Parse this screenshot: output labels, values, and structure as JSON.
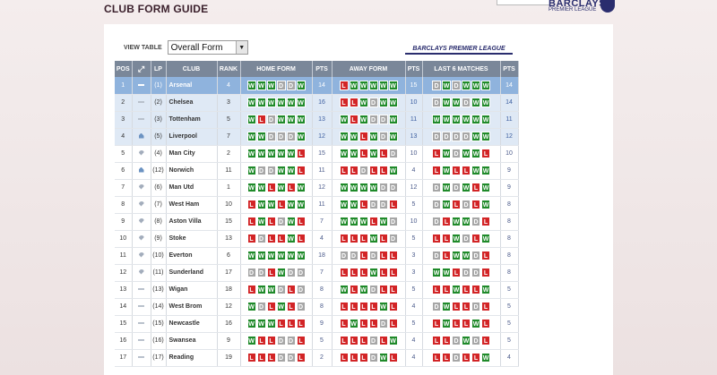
{
  "page_title": "CLUB FORM GUIDE",
  "branding": {
    "top_logo_line1": "BARCLAYS",
    "top_logo_line2": "PREMIER LEAGUE",
    "league_logo": "BARCLAYS PREMIER LEAGUE"
  },
  "controls": {
    "view_table_label": "VIEW TABLE",
    "selected": "Overall Form",
    "arrow": "▼"
  },
  "colors": {
    "win": "#1f8a2a",
    "loss": "#d22426",
    "draw": "#a6a6a6",
    "header": "#7a8799",
    "highlight": "#8fb3dd"
  },
  "columns": [
    "POS",
    "",
    "LP",
    "CLUB",
    "RANK",
    "HOME FORM",
    "PTS",
    "AWAY FORM",
    "PTS",
    "LAST 6 MATCHES",
    "PTS"
  ],
  "columns_icon": "swap-icon",
  "rows": [
    {
      "pos": "1",
      "move": "same",
      "lp": "(1)",
      "club": "Arsenal",
      "rank": "4",
      "home": "WWWDDW",
      "home_pts": "14",
      "away": "LWWWWW",
      "away_pts": "15",
      "last6": "DWDWWW",
      "last6_pts": "14",
      "style": "hl"
    },
    {
      "pos": "2",
      "move": "same",
      "lp": "(2)",
      "club": "Chelsea",
      "rank": "3",
      "home": "WWWWWW",
      "home_pts": "16",
      "away": "LLWDWW",
      "away_pts": "10",
      "last6": "DWWDWW",
      "last6_pts": "14",
      "style": "q"
    },
    {
      "pos": "3",
      "move": "same",
      "lp": "(3)",
      "club": "Tottenham",
      "rank": "5",
      "home": "WLDWWW",
      "home_pts": "13",
      "away": "WLWDDW",
      "away_pts": "11",
      "last6": "WWWWWW",
      "last6_pts": "11",
      "style": "q"
    },
    {
      "pos": "4",
      "move": "up",
      "lp": "(5)",
      "club": "Liverpool",
      "rank": "7",
      "home": "WWDDDW",
      "home_pts": "12",
      "away": "WWLWDW",
      "away_pts": "13",
      "last6": "DDDDWW",
      "last6_pts": "12",
      "style": "q"
    },
    {
      "pos": "5",
      "move": "down",
      "lp": "(4)",
      "club": "Man City",
      "rank": "2",
      "home": "WWWWWL",
      "home_pts": "15",
      "away": "WWLWLD",
      "away_pts": "10",
      "last6": "LWDWWL",
      "last6_pts": "10",
      "style": ""
    },
    {
      "pos": "6",
      "move": "up",
      "lp": "(12)",
      "club": "Norwich",
      "rank": "11",
      "home": "WDDWWL",
      "home_pts": "11",
      "away": "LLDLLW",
      "away_pts": "4",
      "last6": "LWLLWW",
      "last6_pts": "9",
      "style": ""
    },
    {
      "pos": "7",
      "move": "down",
      "lp": "(6)",
      "club": "Man Utd",
      "rank": "1",
      "home": "WWLWLW",
      "home_pts": "12",
      "away": "WWWWDD",
      "away_pts": "12",
      "last6": "DWDWLW",
      "last6_pts": "9",
      "style": ""
    },
    {
      "pos": "8",
      "move": "down",
      "lp": "(7)",
      "club": "West Ham",
      "rank": "10",
      "home": "LWWLWW",
      "home_pts": "11",
      "away": "WWLDDL",
      "away_pts": "5",
      "last6": "DWLDLW",
      "last6_pts": "8",
      "style": ""
    },
    {
      "pos": "9",
      "move": "down",
      "lp": "(8)",
      "club": "Aston Villa",
      "rank": "15",
      "home": "LWLDWL",
      "home_pts": "7",
      "away": "WWWLWD",
      "away_pts": "10",
      "last6": "DLWWDL",
      "last6_pts": "8",
      "style": ""
    },
    {
      "pos": "10",
      "move": "down",
      "lp": "(9)",
      "club": "Stoke",
      "rank": "13",
      "home": "LDLLWL",
      "home_pts": "4",
      "away": "LLLWLD",
      "away_pts": "5",
      "last6": "LLWDLW",
      "last6_pts": "8",
      "style": ""
    },
    {
      "pos": "11",
      "move": "down",
      "lp": "(10)",
      "club": "Everton",
      "rank": "6",
      "home": "WWWWWW",
      "home_pts": "18",
      "away": "DDLDLL",
      "away_pts": "3",
      "last6": "DLWWDL",
      "last6_pts": "8",
      "style": ""
    },
    {
      "pos": "12",
      "move": "down",
      "lp": "(11)",
      "club": "Sunderland",
      "rank": "17",
      "home": "DDLWDD",
      "home_pts": "7",
      "away": "LLLWLL",
      "away_pts": "3",
      "last6": "WWLDDL",
      "last6_pts": "8",
      "style": ""
    },
    {
      "pos": "13",
      "move": "same",
      "lp": "(13)",
      "club": "Wigan",
      "rank": "18",
      "home": "LWWDLD",
      "home_pts": "8",
      "away": "WLWDLL",
      "away_pts": "5",
      "last6": "LLWLLW",
      "last6_pts": "5",
      "style": ""
    },
    {
      "pos": "14",
      "move": "same",
      "lp": "(14)",
      "club": "West Brom",
      "rank": "12",
      "home": "WDLWLD",
      "home_pts": "8",
      "away": "LLLLWL",
      "away_pts": "4",
      "last6": "DWLLDL",
      "last6_pts": "5",
      "style": ""
    },
    {
      "pos": "15",
      "move": "same",
      "lp": "(15)",
      "club": "Newcastle",
      "rank": "16",
      "home": "WWWLLL",
      "home_pts": "9",
      "away": "LWLLDL",
      "away_pts": "5",
      "last6": "LWLLWL",
      "last6_pts": "5",
      "style": ""
    },
    {
      "pos": "16",
      "move": "same",
      "lp": "(16)",
      "club": "Swansea",
      "rank": "9",
      "home": "WLLDDL",
      "home_pts": "5",
      "away": "LLLDLW",
      "away_pts": "4",
      "last6": "LLDWDL",
      "last6_pts": "5",
      "style": ""
    },
    {
      "pos": "17",
      "move": "same",
      "lp": "(17)",
      "club": "Reading",
      "rank": "19",
      "home": "LLLDDL",
      "home_pts": "2",
      "away": "LLLDWL",
      "away_pts": "4",
      "last6": "LLDLLW",
      "last6_pts": "4",
      "style": ""
    }
  ]
}
